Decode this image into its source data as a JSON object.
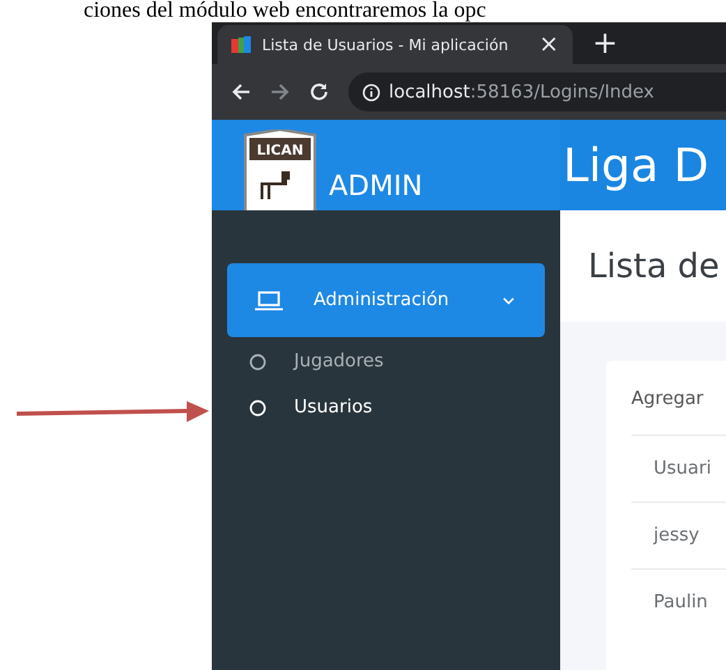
{
  "document_text": "ciones del módulo web encontraremos la opc",
  "browser": {
    "tab": {
      "title": "Lista de Usuarios - Mi aplicación",
      "close": "×"
    },
    "new_tab": "+",
    "url_host": "localhost",
    "url_path": ":58163/Logins/Index"
  },
  "app": {
    "logo_text": "LICAN",
    "brand": "ADMIN",
    "header_title": "Liga D",
    "sidebar": {
      "menu": {
        "label": "Administración",
        "expanded": true
      },
      "items": [
        {
          "label": "Jugadores",
          "selected": false
        },
        {
          "label": "Usuarios",
          "selected": true
        }
      ]
    },
    "page_title": "Lista de",
    "card": {
      "action": "Agregar",
      "rows": [
        "Usuari",
        "jessy",
        "Paulin"
      ]
    }
  }
}
